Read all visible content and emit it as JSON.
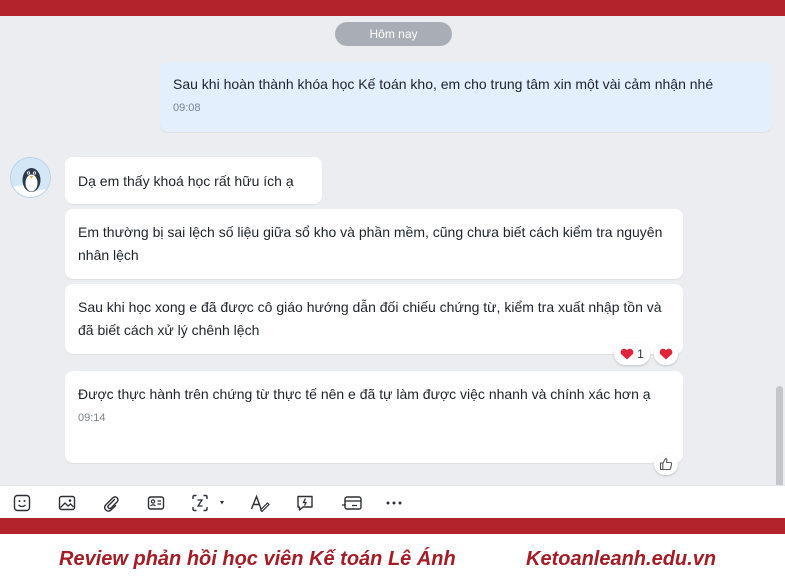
{
  "date_separator": "Hôm nay",
  "outgoing_message": {
    "text": "Sau khi hoàn thành khóa học Kế toán kho, em cho trung tâm xin một vài cảm nhận nhé",
    "time": "09:08"
  },
  "incoming_messages": [
    {
      "text": "Dạ em thấy khoá học rất hữu ích ạ"
    },
    {
      "text": "Em thường bị sai lệch số liệu giữa sổ kho và phần mềm, cũng chưa biết cách kiểm tra nguyên nhân lệch"
    },
    {
      "text": "Sau khi học xong e đã được cô giáo hướng dẫn đối chiếu chứng từ, kiểm tra xuất nhập tồn và đã biết cách xử lý chênh lệch"
    },
    {
      "text": "Được thực hành trên chứng từ thực tế nên e đã tự làm được việc nhanh và chính xác hơn ạ",
      "time": "09:14"
    }
  ],
  "reaction": {
    "icon": "heart-icon",
    "count": "1"
  },
  "toolbar_icons": [
    "sticker-icon",
    "image-icon",
    "paperclip-icon",
    "contact-card-icon",
    "screenshot-icon",
    "format-text-icon",
    "quick-message-icon",
    "card-icon",
    "more-icon"
  ],
  "footer": {
    "left_text": "Review phản hồi học viên Kế toán Lê Ánh",
    "right_text": "Ketoanleanh.edu.vn"
  },
  "colors": {
    "brand_red": "#b3232b",
    "footer_text": "#a31d26",
    "outgoing_bubble": "#e3effd",
    "chat_background": "#ebedf0",
    "heart": "#e0243a"
  }
}
